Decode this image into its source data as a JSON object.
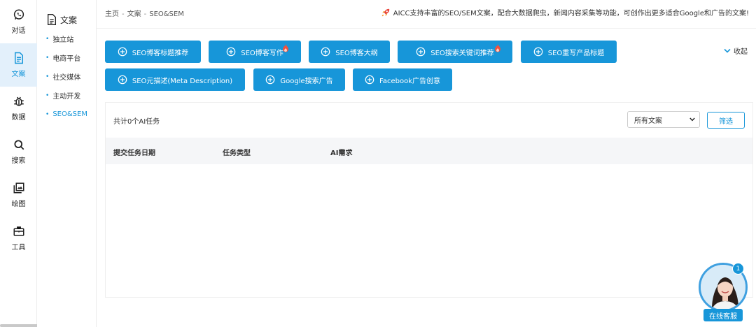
{
  "rail": {
    "items": [
      {
        "label": "对话",
        "icon": "whatsapp-icon"
      },
      {
        "label": "文案",
        "icon": "document-icon",
        "active": true
      },
      {
        "label": "数据",
        "icon": "bug-icon"
      },
      {
        "label": "搜索",
        "icon": "search-icon"
      },
      {
        "label": "绘图",
        "icon": "image-icon"
      },
      {
        "label": "工具",
        "icon": "toolbox-icon"
      }
    ]
  },
  "subnav": {
    "title": "文案",
    "items": [
      "独立站",
      "电商平台",
      "社交媒体",
      "主动开发",
      "SEO&SEM"
    ],
    "active": "SEO&SEM"
  },
  "breadcrumb": {
    "home": "主页",
    "section": "文案",
    "page": "SEO&SEM",
    "sep": "-"
  },
  "notice": {
    "text": "AICC支持丰富的SEO/SEM文案，配合大数据爬虫，新闻内容采集等功能，可创作出更多适合Google和广告的文案!"
  },
  "actions": {
    "buttons": [
      {
        "label": "SEO博客标题推荐",
        "hot": false
      },
      {
        "label": "SEO博客写作",
        "hot": true
      },
      {
        "label": "SEO博客大纲",
        "hot": false
      },
      {
        "label": "SEO搜索关键词推荐",
        "hot": true
      },
      {
        "label": "SEO重写产品标题",
        "hot": false
      },
      {
        "label": "SEO元描述(Meta Description)",
        "hot": false
      },
      {
        "label": "Google搜索广告",
        "hot": false
      },
      {
        "label": "Facebook广告创意",
        "hot": false
      }
    ],
    "collapse_label": "收起"
  },
  "tasks": {
    "count_text": "共计0个AI任务",
    "filter_select": "所有文案",
    "filter_button": "筛选",
    "columns": [
      "提交任务日期",
      "任务类型",
      "AI需求"
    ],
    "rows": []
  },
  "chat": {
    "label": "在线客服",
    "badge": "1"
  },
  "colors": {
    "accent": "#1796d9",
    "active_bg": "#e3f0fb"
  }
}
